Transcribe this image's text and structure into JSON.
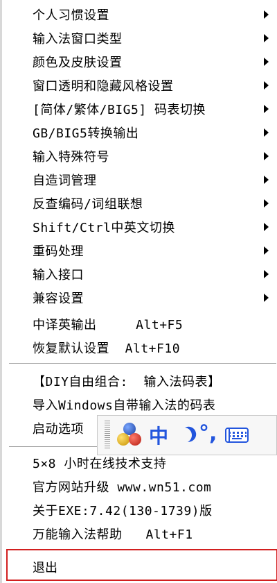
{
  "menu": {
    "items": [
      {
        "label": "个人习惯设置",
        "submenu": true
      },
      {
        "label": "输入法窗口类型",
        "submenu": true
      },
      {
        "label": "颜色及皮肤设置",
        "submenu": true
      },
      {
        "label": "窗口透明和隐藏风格设置",
        "submenu": true
      },
      {
        "label": "[简体/繁体/BIG5] 码表切换",
        "submenu": true
      },
      {
        "label": "GB/BIG5转换输出",
        "submenu": true
      },
      {
        "label": "输入特殊符号",
        "submenu": true
      },
      {
        "label": "自造词管理",
        "submenu": true
      },
      {
        "label": "反查编码/词组联想",
        "submenu": true
      },
      {
        "label": "Shift/Ctrl中英文切换",
        "submenu": true
      },
      {
        "label": "重码处理",
        "submenu": true
      },
      {
        "label": "输入接口",
        "submenu": true
      },
      {
        "label": "兼容设置",
        "submenu": true
      },
      {
        "label": "中译英输出     Alt+F5",
        "submenu": false
      },
      {
        "label": "恢复默认设置  Alt+F10",
        "submenu": false
      }
    ],
    "diy_items": [
      {
        "label": "【DIY自由组合:  输入法码表】"
      },
      {
        "label": "导入Windows自带输入法的码表"
      },
      {
        "label": "启动选项"
      }
    ],
    "support_items": [
      {
        "label": "5×8 小时在线技术支持"
      },
      {
        "label": "官方网站升级 www.wn51.com"
      },
      {
        "label": "关于EXE:7.42(130-1739)版"
      },
      {
        "label": "万能输入法帮助   Alt+F1"
      }
    ],
    "exit_label": "退出"
  },
  "ime_toolbar": {
    "mode_label": "中",
    "punct_label": "°,",
    "icons": [
      "grip-handle",
      "ime-logo-icon",
      "half-width-moon-icon",
      "soft-keyboard-icon"
    ],
    "colors": {
      "accent": "#2255dd",
      "exit_border": "#d21f1f"
    }
  }
}
